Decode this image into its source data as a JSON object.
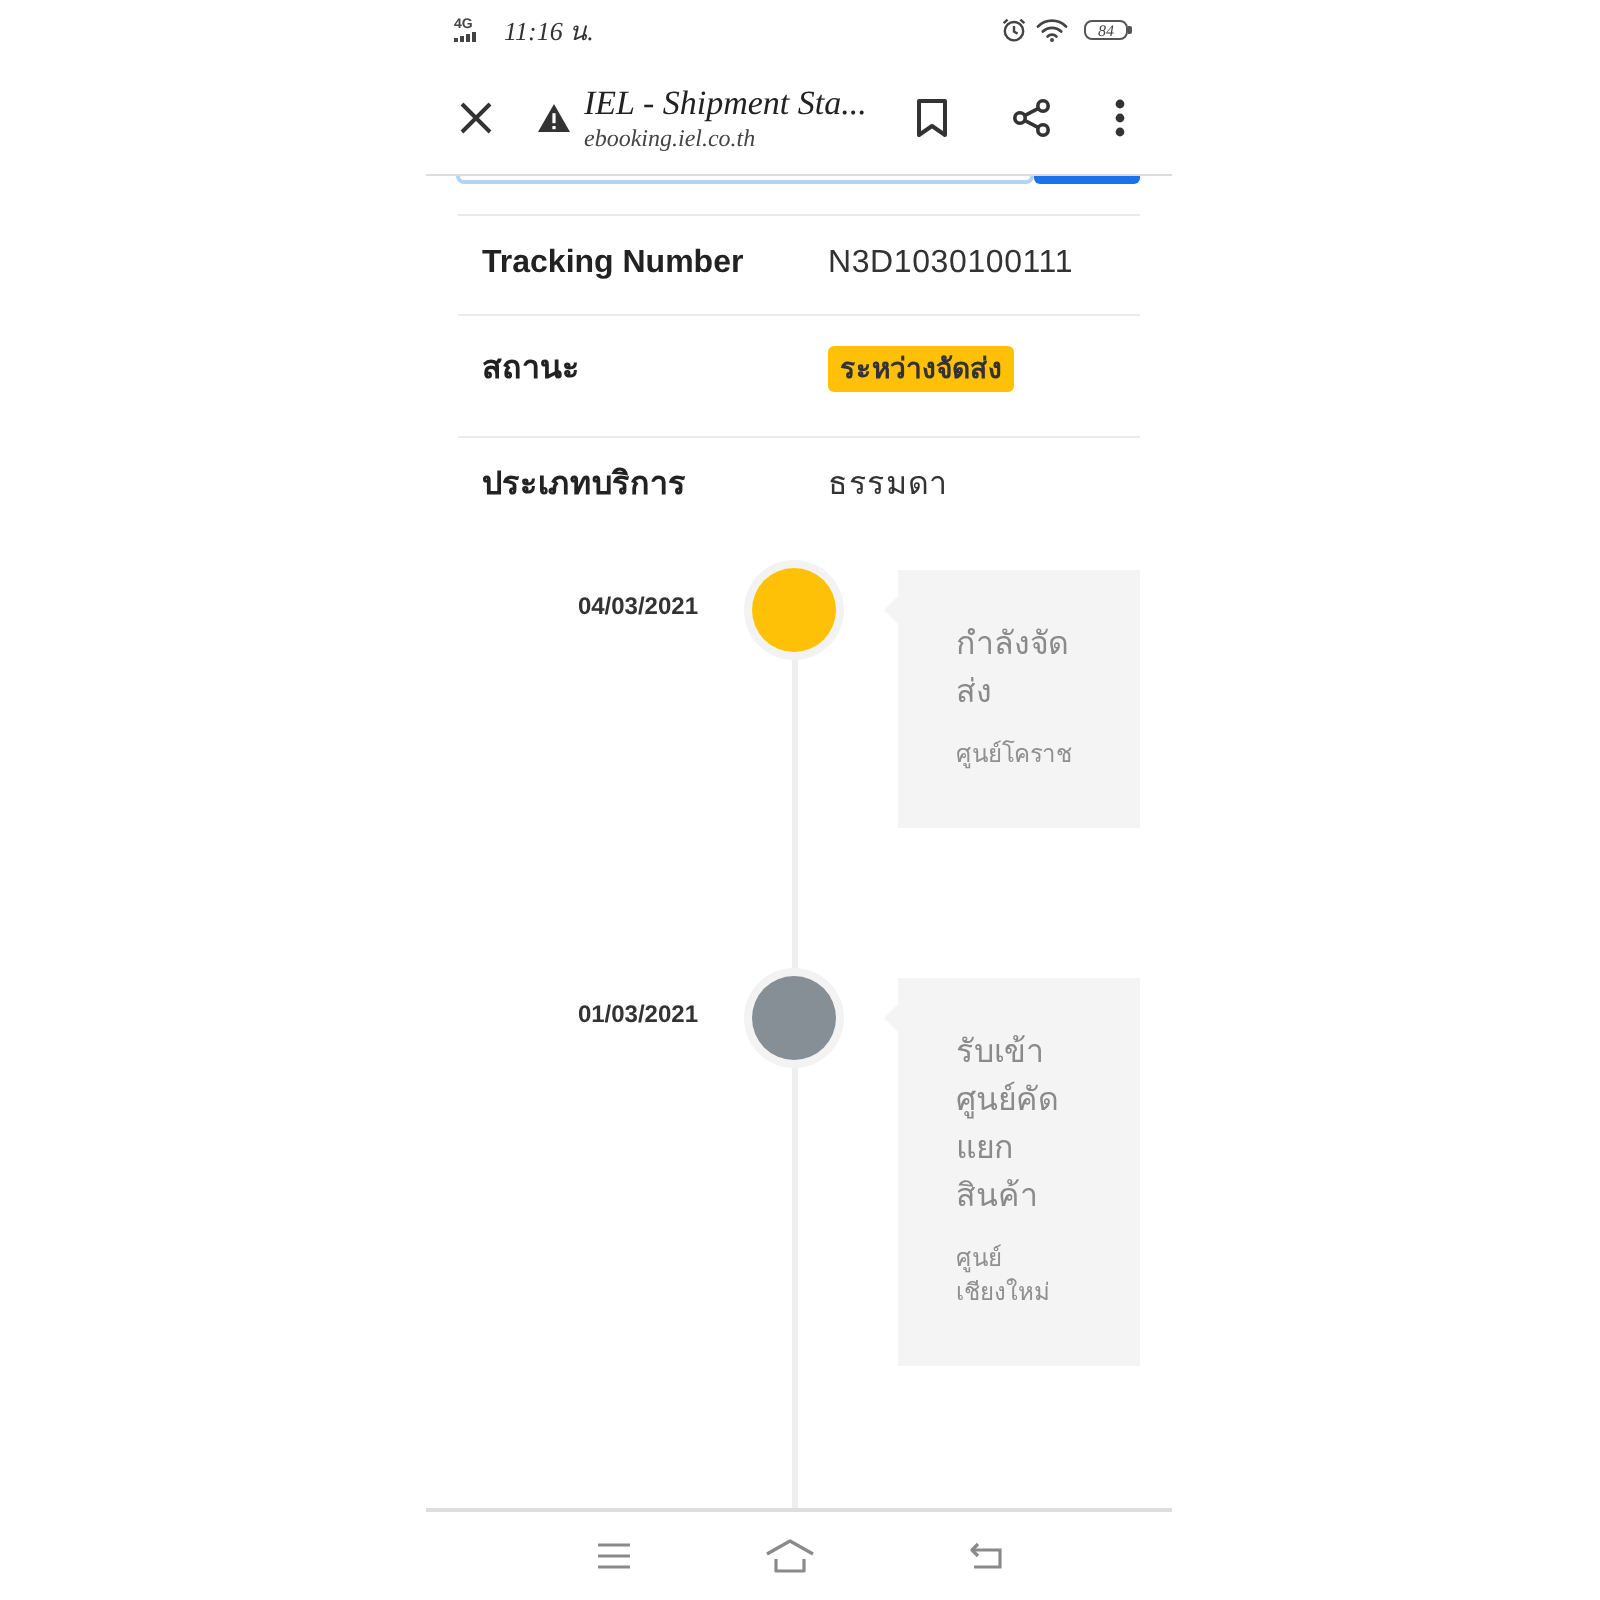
{
  "status_bar": {
    "network": "4G",
    "time": "11:16 น.",
    "battery": "84"
  },
  "browser_bar": {
    "title": "IEL - Shipment Sta...",
    "url": "ebooking.iel.co.th"
  },
  "details": [
    {
      "label": "Tracking Number",
      "value": "N3D1030100111",
      "kind": "text"
    },
    {
      "label": "สถานะ",
      "value": "ระหว่างจัดส่ง",
      "kind": "badge"
    },
    {
      "label": "ประเภทบริการ",
      "value": "ธรรมดา",
      "kind": "text"
    }
  ],
  "timeline": [
    {
      "date": "04/03/2021",
      "color": "#ffc107",
      "title": "กำลังจัดส่ง",
      "location": "ศูนย์โคราช"
    },
    {
      "date": "01/03/2021",
      "color": "#868e96",
      "title": "รับเข้าศูนย์คัดแยกสินค้า",
      "location": "ศูนย์เชียงใหม่"
    }
  ]
}
